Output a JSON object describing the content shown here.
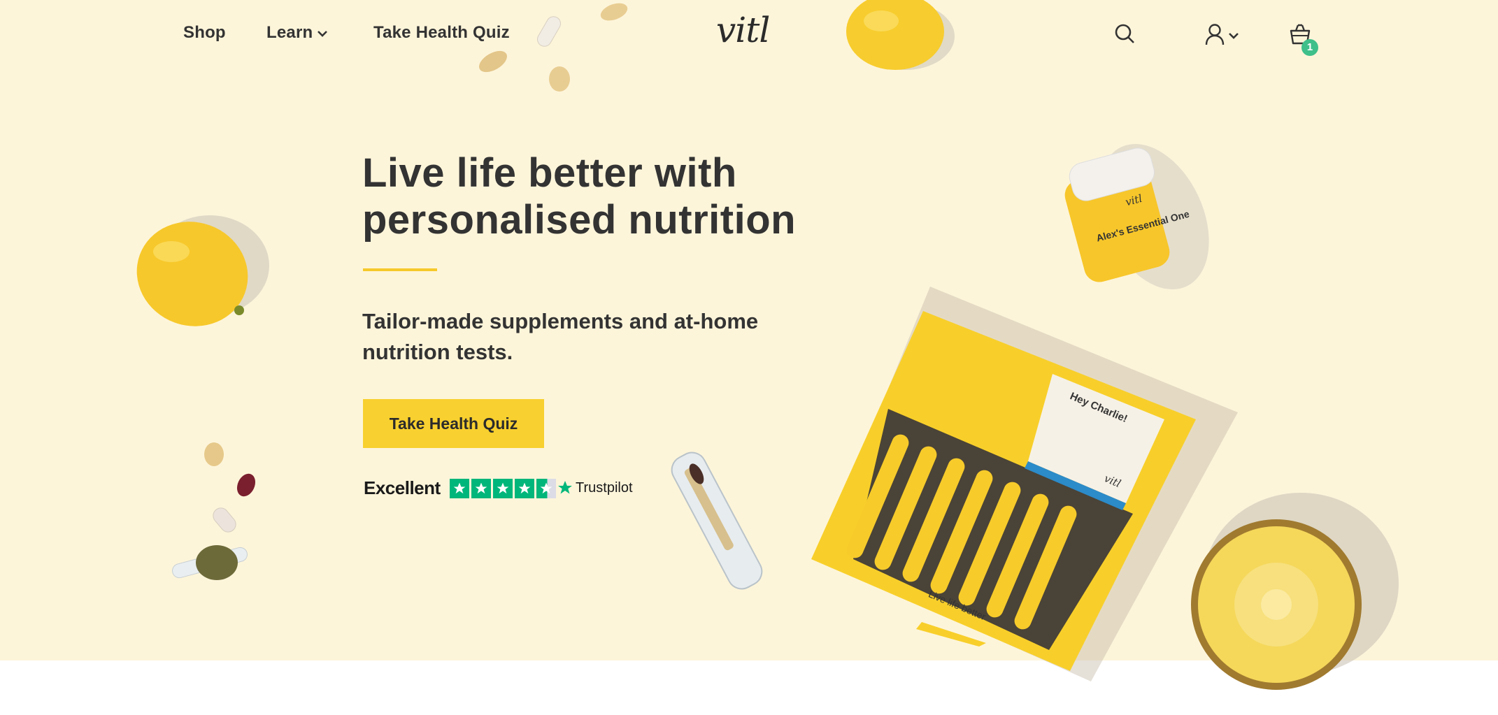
{
  "nav": {
    "shop": "Shop",
    "learn": "Learn",
    "quiz": "Take Health Quiz"
  },
  "logo": "vitl",
  "header_icons": {
    "search": "search-icon",
    "account": "user-icon",
    "cart": "basket-icon",
    "cart_count": "1"
  },
  "hero": {
    "headline_line1": "Live life better with",
    "headline_line2": "personalised nutrition",
    "subhead": "Tailor-made supplements and at-home nutrition tests.",
    "cta": "Take Health Quiz",
    "rating_label": "Excellent",
    "rating_stars": 4.5,
    "rating_brand": "Trustpilot"
  },
  "product_labels": {
    "bottle_name": "Alex's Essential One",
    "bottle_brand": "vitl",
    "card_greeting": "Hey Charlie!",
    "box_brand": "vitl",
    "box_slogan": "Live life better"
  },
  "colors": {
    "hero_bg": "#fdf5da",
    "accent_yellow": "#f8d02f",
    "text_dark": "#333333",
    "badge_green": "#3fbf8a",
    "trustpilot_green": "#00b67a"
  }
}
